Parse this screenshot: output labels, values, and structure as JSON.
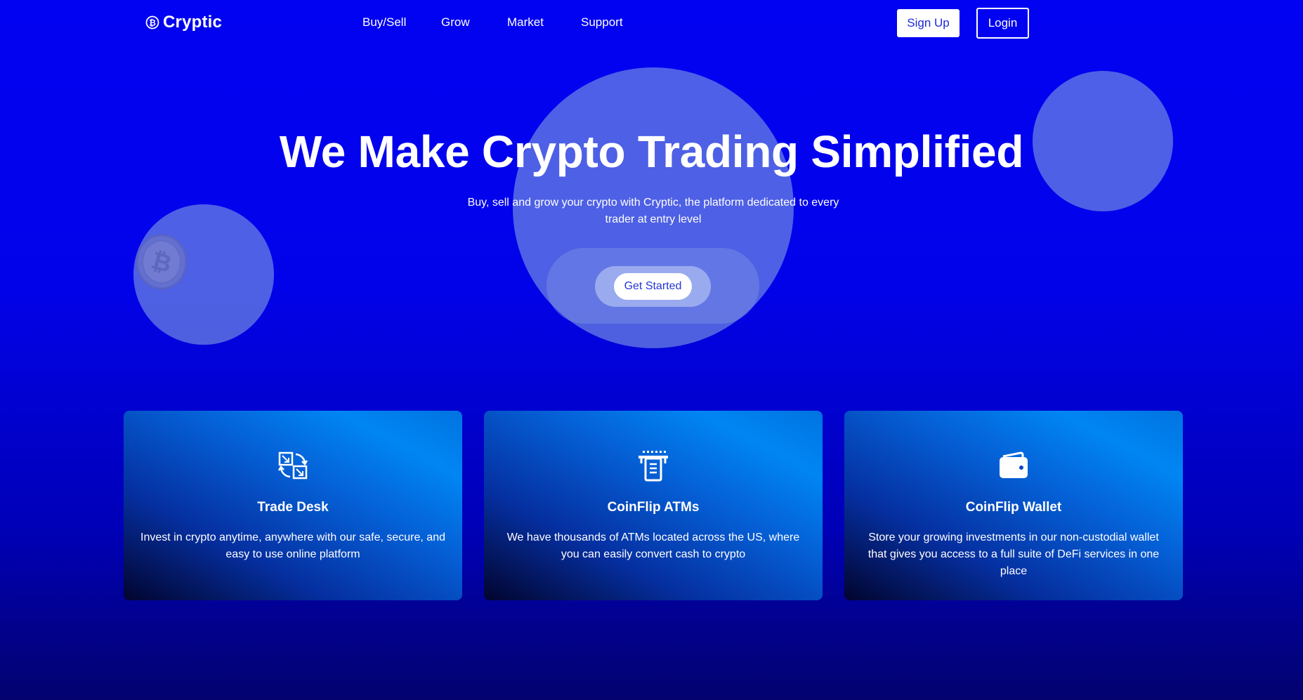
{
  "brand": {
    "name": "Cryptic",
    "icon": "bitcoin-icon"
  },
  "nav": {
    "links": [
      "Buy/Sell",
      "Grow",
      "Market",
      "Support"
    ],
    "signup_label": "Sign Up",
    "login_label": "Login"
  },
  "hero": {
    "title": "We Make Crypto Trading Simplified",
    "subtitle": "Buy, sell and grow your crypto with Cryptic, the platform dedicated to every trader at entry level",
    "cta_label": "Get Started"
  },
  "features": [
    {
      "icon": "exchange-icon",
      "title": "Trade Desk",
      "description": "Invest in crypto anytime, anywhere with our safe, secure, and easy to use online platform"
    },
    {
      "icon": "atm-icon",
      "title": "CoinFlip ATMs",
      "description": "We have thousands of ATMs located across the US, where you can easily convert cash to crypto"
    },
    {
      "icon": "wallet-icon",
      "title": "CoinFlip Wallet",
      "description": "Store your growing investments in our non-custodial wallet that gives you access to a full suite of DeFi services in one place"
    }
  ],
  "colors": {
    "background": "#0202f2",
    "accent": "#2336d6",
    "card_gradient_start": "#02042e",
    "card_gradient_end": "#0086f3"
  }
}
